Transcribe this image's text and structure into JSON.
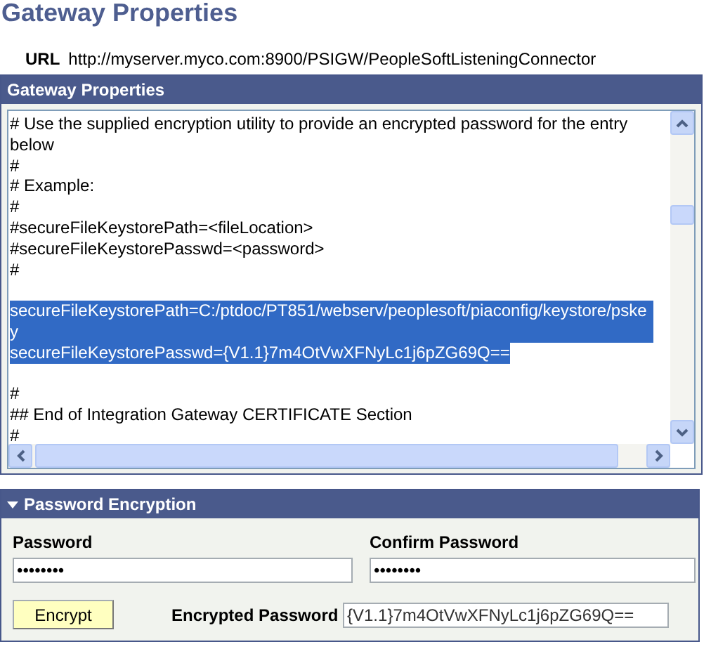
{
  "page_title": "Gateway Properties",
  "url": {
    "label": "URL",
    "value": "http://myserver.myco.com:8900/PSIGW/PeopleSoftListeningConnector"
  },
  "gateway_panel": {
    "title": "Gateway Properties",
    "lines": [
      {
        "text": "# Use the supplied encryption utility to provide an encrypted password for the entry below",
        "selected": false,
        "gap_before": false
      },
      {
        "text": "#",
        "selected": false,
        "gap_before": false
      },
      {
        "text": "# Example:",
        "selected": false,
        "gap_before": false
      },
      {
        "text": "#",
        "selected": false,
        "gap_before": false
      },
      {
        "text": "#secureFileKeystorePath=<fileLocation>",
        "selected": false,
        "gap_before": false
      },
      {
        "text": "#secureFileKeystorePasswd=<password>",
        "selected": false,
        "gap_before": false
      },
      {
        "text": "#",
        "selected": false,
        "gap_before": false
      },
      {
        "text": "secureFileKeystorePath=C:/ptdoc/PT851/webserv/peoplesoft/piaconfig/keystore/pskey",
        "selected": true,
        "gap_before": true
      },
      {
        "text": "secureFileKeystorePasswd={V1.1}7m4OtVwXFNyLc1j6pZG69Q==",
        "selected": true,
        "gap_before": false
      },
      {
        "text": "#",
        "selected": false,
        "gap_before": true
      },
      {
        "text": "## End of Integration Gateway CERTIFICATE Section",
        "selected": false,
        "gap_before": false
      },
      {
        "text": "#",
        "selected": false,
        "gap_before": false
      }
    ]
  },
  "encryption_panel": {
    "title": "Password Encryption",
    "expanded": true,
    "password": {
      "label": "Password",
      "value": "••••••••"
    },
    "confirm_password": {
      "label": "Confirm Password",
      "value": "••••••••"
    },
    "encrypt_button": "Encrypt",
    "encrypted_password": {
      "label": "Encrypted Password",
      "value": "{V1.1}7m4OtVwXFNyLc1j6pZG69Q=="
    }
  }
}
